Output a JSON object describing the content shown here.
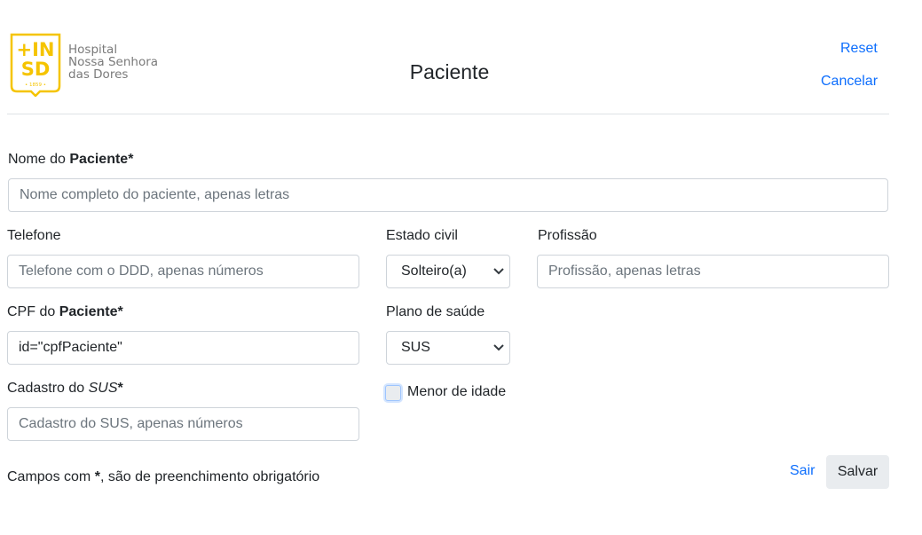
{
  "logo": {
    "mark_top": "+IN",
    "mark_bottom": "SD",
    "mark_year": "• 1859 •",
    "line1": "Hospital",
    "line2": "Nossa Senhora",
    "line3": "das Dores",
    "color": "#F5C400"
  },
  "header": {
    "title": "Paciente",
    "reset_label": "Reset",
    "cancel_label": "Cancelar"
  },
  "form": {
    "nome": {
      "label_prefix": "Nome do ",
      "label_bold": "Paciente*",
      "placeholder": "Nome completo do paciente, apenas letras"
    },
    "telefone": {
      "label": "Telefone",
      "placeholder": "Telefone com o DDD, apenas números"
    },
    "estado_civil": {
      "label": "Estado civil",
      "value": "Solteiro(a)"
    },
    "profissao": {
      "label": "Profissão",
      "placeholder": "Profissão, apenas letras"
    },
    "cpf": {
      "label_prefix": "CPF do ",
      "label_bold": "Paciente*",
      "value": "id=\"cpfPaciente\""
    },
    "plano": {
      "label": "Plano de saúde",
      "value": "SUS"
    },
    "sus": {
      "label_prefix": "Cadastro do ",
      "label_italic": "SUS",
      "label_star": "*",
      "placeholder": "Cadastro do SUS, apenas números"
    },
    "menor": {
      "label": "Menor de idade",
      "checked": false
    }
  },
  "footer": {
    "note_prefix": "Campos com ",
    "note_star": "*",
    "note_suffix": ", são de preenchimento obrigatório",
    "sair_label": "Sair",
    "salvar_label": "Salvar"
  },
  "colors": {
    "link": "#0d6efd",
    "border": "#ced4da",
    "button_bg": "#e9ecef"
  }
}
